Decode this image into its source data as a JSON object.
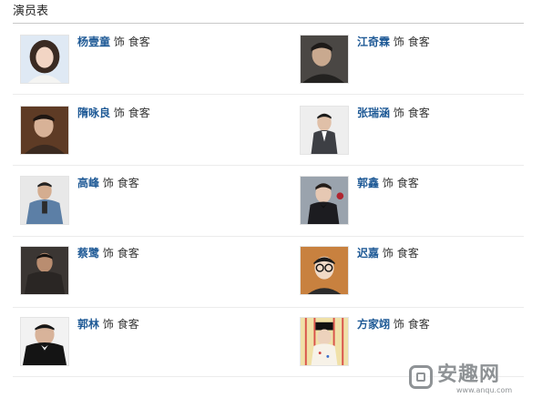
{
  "section": {
    "title": "演员表"
  },
  "cast": [
    {
      "actor": "杨壹童",
      "sep": "饰",
      "role": "食客"
    },
    {
      "actor": "江奇霖",
      "sep": "饰",
      "role": "食客"
    },
    {
      "actor": "隋咏良",
      "sep": "饰",
      "role": "食客"
    },
    {
      "actor": "张瑞涵",
      "sep": "饰",
      "role": "食客"
    },
    {
      "actor": "高峰",
      "sep": "饰",
      "role": "食客"
    },
    {
      "actor": "郭鑫",
      "sep": "饰",
      "role": "食客"
    },
    {
      "actor": "蔡鹭",
      "sep": "饰",
      "role": "食客"
    },
    {
      "actor": "迟嘉",
      "sep": "饰",
      "role": "食客"
    },
    {
      "actor": "郭林",
      "sep": "饰",
      "role": "食客"
    },
    {
      "actor": "方家翊",
      "sep": "饰",
      "role": "食客"
    }
  ],
  "watermark": {
    "brand": "安趣网",
    "url": "www.anqu.com"
  }
}
